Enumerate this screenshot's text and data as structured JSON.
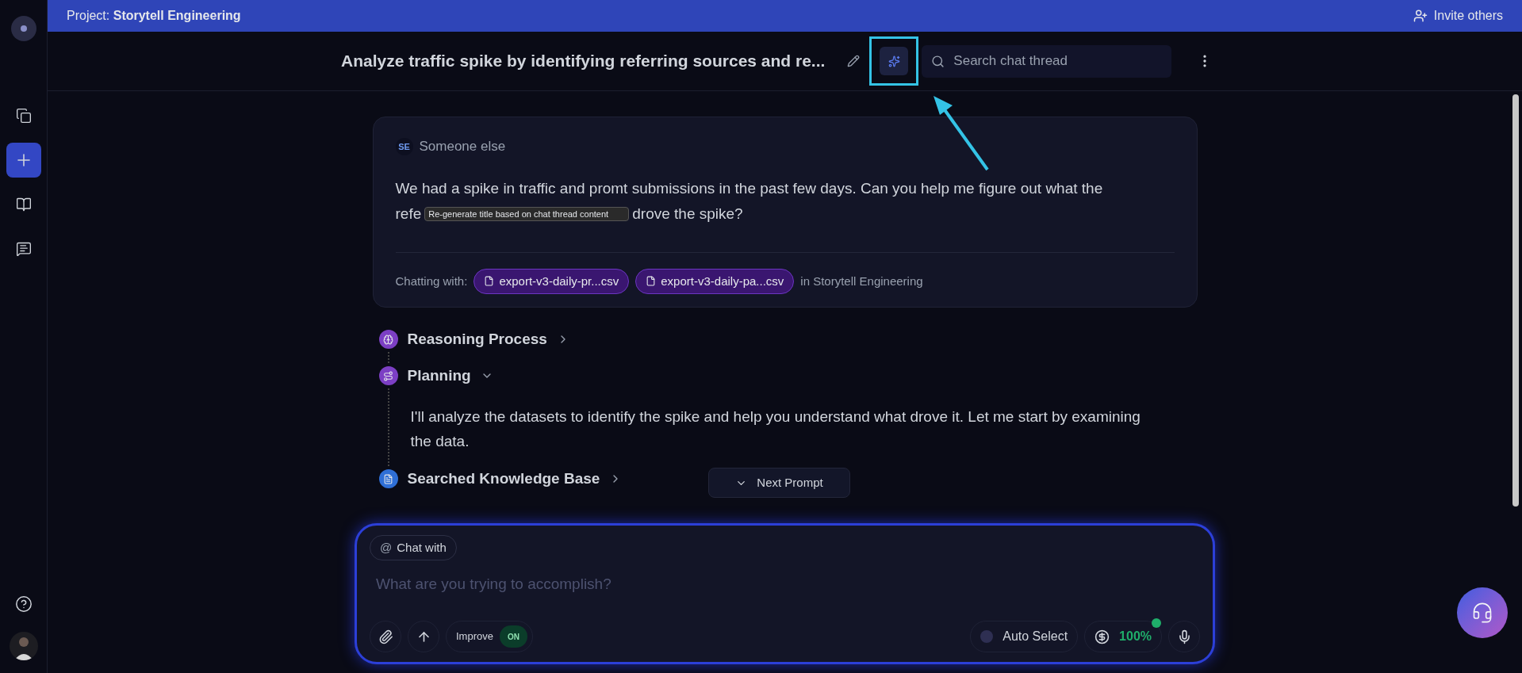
{
  "project": {
    "label": "Project:",
    "name": "Storytell Engineering"
  },
  "invite": {
    "label": "Invite others"
  },
  "sidebar": {
    "items": [
      {
        "kind": "copy",
        "selected": false
      },
      {
        "kind": "new",
        "selected": true
      },
      {
        "kind": "book",
        "selected": false
      },
      {
        "kind": "chat",
        "selected": false
      }
    ]
  },
  "thread": {
    "title": "Analyze traffic spike by identifying referring sources and re...",
    "regenerate_highlighted": true,
    "search": {
      "placeholder": "Search chat thread"
    }
  },
  "message": {
    "initials": "SE",
    "author": "Someone else",
    "line_1": "We had a spike in traffic and promt submissions in the past few days. Can you help me figure out what the",
    "line_2_start": "refe",
    "line_2_end": "drove the spike?",
    "tooltip": "Re-generate title based on chat thread content",
    "chatting_label": "Chatting with:",
    "files": [
      "export-v3-daily-pr...csv",
      "export-v3-daily-pa...csv"
    ],
    "scope": "in Storytell Engineering"
  },
  "steps": [
    {
      "kind": "reasoning",
      "label": "Reasoning Process",
      "expanded": false,
      "color": "#7c3fc4"
    },
    {
      "kind": "planning",
      "label": "Planning",
      "expanded": true,
      "color": "#7c3fc4",
      "body": "I'll analyze the datasets to identify the spike and help you understand what drove it. Let me start by examining the data."
    },
    {
      "kind": "search",
      "label": "Searched Knowledge Base",
      "expanded": false,
      "color": "#2f6fd6"
    }
  ],
  "next_prompt": "Next Prompt",
  "composer": {
    "chat_with": "Chat with",
    "at": "@",
    "placeholder": "What are you trying to accomplish?",
    "improve": {
      "label": "Improve",
      "on": true,
      "on_text": "ON"
    },
    "model": "Auto Select",
    "budget": "100%"
  }
}
